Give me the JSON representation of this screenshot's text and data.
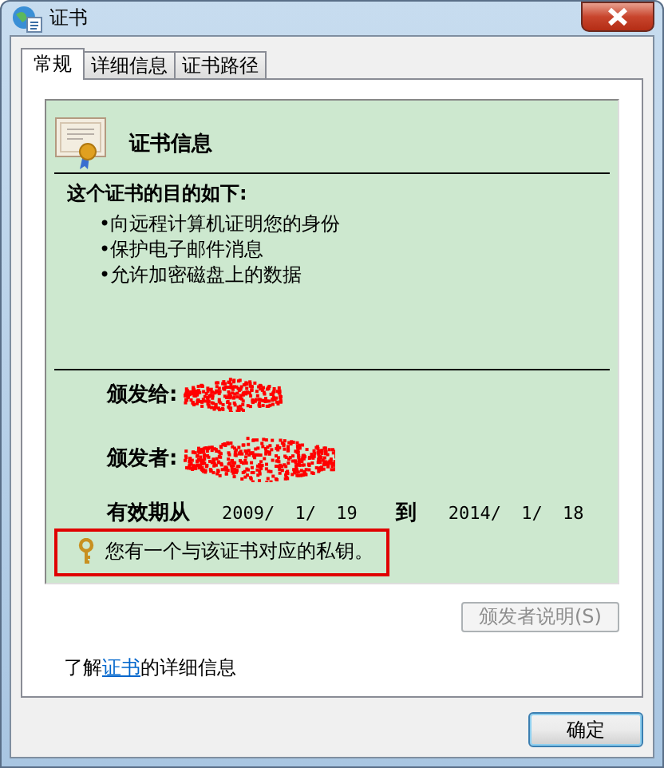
{
  "window": {
    "title": "证书"
  },
  "tabs": [
    {
      "label": "常规",
      "selected": true
    },
    {
      "label": "详细信息",
      "selected": false
    },
    {
      "label": "证书路径",
      "selected": false
    }
  ],
  "certificate_info": {
    "title": "证书信息",
    "purpose_heading": "这个证书的目的如下:",
    "purposes": [
      "•向远程计算机证明您的身份",
      "•保护电子邮件消息",
      "•允许加密磁盘上的数据"
    ],
    "issued_to_label": "颁发给:",
    "issued_by_label": "颁发者:",
    "valid_from_label": "有效期从",
    "valid_from": "2009/ 1/ 19",
    "to_label": "到",
    "valid_to": "2014/ 1/ 18",
    "private_key_note": "您有一个与该证书对应的私钥。",
    "note_highlighted": true
  },
  "issuer_statement_button": {
    "label": "颁发者说明(S)",
    "disabled": true
  },
  "learn_more": {
    "before": "了解",
    "link": "证书",
    "after": "的详细信息"
  },
  "buttons": [
    {
      "label": "确定"
    }
  ]
}
